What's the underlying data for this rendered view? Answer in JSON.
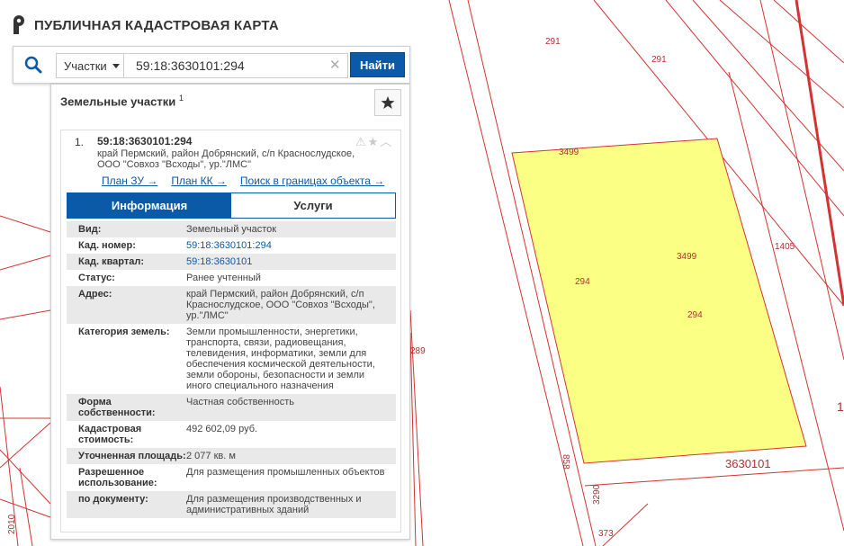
{
  "app": {
    "title": "ПУБЛИЧНАЯ КАДАСТРОВАЯ КАРТА"
  },
  "colors": {
    "accent": "#0b5aa8",
    "parcel_fill": "#fbff84",
    "map_line": "#d33333"
  },
  "search": {
    "type_label": "Участки",
    "value": "59:18:3630101:294",
    "find_label": "Найти"
  },
  "panel": {
    "heading": "Земельные участки",
    "count": "1",
    "card": {
      "index": "1.",
      "number": "59:18:3630101:294",
      "address": "край Пермский, район Добрянский, с/п Краснослудское, ООО \"Совхоз \"Всходы\", ур.\"ЛМС\"",
      "links": [
        "План ЗУ →",
        "План КК →",
        "Поиск в границах объекта →"
      ],
      "tabs": {
        "info": "Информация",
        "services": "Услуги"
      },
      "attributes": [
        {
          "key": "Вид:",
          "value": "Земельный участок",
          "link": false
        },
        {
          "key": "Кад. номер:",
          "value": "59:18:3630101:294",
          "link": true
        },
        {
          "key": "Кад. квартал:",
          "value": "59:18:3630101",
          "link": true
        },
        {
          "key": "Статус:",
          "value": "Ранее учтенный",
          "link": false
        },
        {
          "key": "Адрес:",
          "value": "край Пермский, район Добрянский, с/п Краснослудское, ООО \"Совхоз \"Всходы\", ур.\"ЛМС\"",
          "link": false
        },
        {
          "key": "Категория земель:",
          "value": "Земли промышленности, энергетики, транспорта, связи, радиовещания, телевидения, информатики, земли для обеспечения космической деятельности, земли обороны, безопасности и земли иного специального назначения",
          "link": false
        },
        {
          "key": "Форма собственности:",
          "value": "Частная собственность",
          "link": false
        },
        {
          "key": "Кадастровая стоимость:",
          "value": "492 602,09 руб.",
          "link": false
        },
        {
          "key": "Уточненная площадь:",
          "value": "2 077 кв. м",
          "link": false
        },
        {
          "key": "Разрешенное использование:",
          "value": "Для размещения промышленных объектов",
          "link": false
        },
        {
          "key": "по документу:",
          "value": "Для размещения производственных и административных зданий",
          "link": false
        }
      ]
    }
  },
  "map": {
    "labels": [
      "291",
      "291",
      "3499",
      "3499",
      "294",
      "294",
      "1405",
      "289",
      "858",
      "3630101",
      "3290",
      "373",
      "2010",
      "1"
    ]
  }
}
